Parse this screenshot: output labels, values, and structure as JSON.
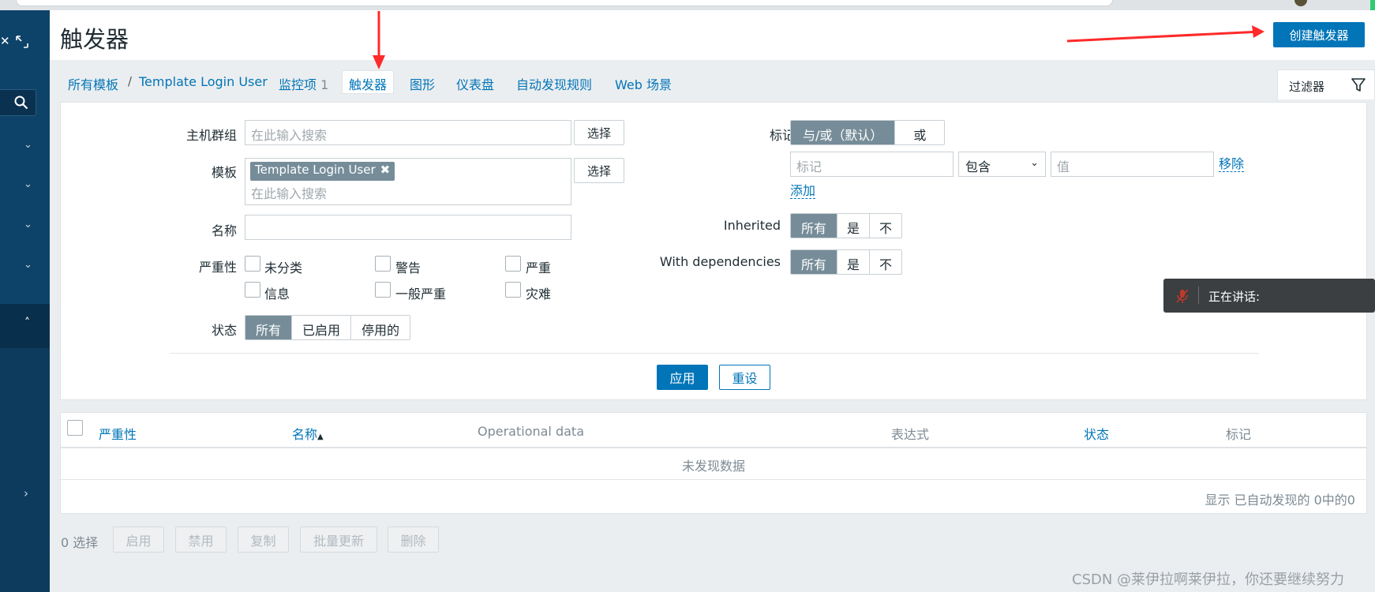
{
  "header": {
    "page_title": "触发器",
    "create_button": "创建触发器"
  },
  "nav": {
    "breadcrumb_all_templates": "所有模板",
    "breadcrumb_sep": "/",
    "breadcrumb_template": "Template Login User",
    "items_label": "监控项",
    "items_count": "1",
    "triggers": "触发器",
    "graphs": "图形",
    "dashboards": "仪表盘",
    "discovery_rules": "自动发现规则",
    "web_scenarios": "Web 场景",
    "filter_tab": "过滤器"
  },
  "filter": {
    "host_group_label": "主机群组",
    "host_group_placeholder": "在此输入搜索",
    "select_button": "选择",
    "template_label": "模板",
    "template_chip": "Template Login User",
    "template_placeholder": "在此输入搜索",
    "name_label": "名称",
    "name_value": "",
    "severity_label": "严重性",
    "severities": [
      "未分类",
      "警告",
      "严重",
      "信息",
      "一般严重",
      "灾难"
    ],
    "status_label": "状态",
    "status_options": [
      "所有",
      "已启用",
      "停用的"
    ],
    "tags_label": "标记",
    "tags_mode_options": [
      "与/或（默认）",
      "或"
    ],
    "tag_placeholder": "标记",
    "tag_operator": "包含",
    "tag_value_placeholder": "值",
    "remove_link": "移除",
    "add_link": "添加",
    "inherited_label": "Inherited",
    "inherited_options": [
      "所有",
      "是",
      "不"
    ],
    "deps_label": "With dependencies",
    "deps_options": [
      "所有",
      "是",
      "不"
    ],
    "apply_button": "应用",
    "reset_button": "重设"
  },
  "toast": {
    "text": "正在讲话:"
  },
  "table": {
    "columns": {
      "severity": "严重性",
      "name": "名称",
      "name_sort": "▲",
      "operational_data": "Operational data",
      "expression": "表达式",
      "status": "状态",
      "tags": "标记"
    },
    "empty_text": "未发现数据",
    "footer": "显示 已自动发现的 0中的0"
  },
  "actions": {
    "selected": "0 选择",
    "enable": "启用",
    "disable": "禁用",
    "copy": "复制",
    "mass_update": "批量更新",
    "delete": "删除"
  },
  "watermark": "CSDN @莱伊拉啊莱伊拉，你还要继续努力",
  "colors": {
    "sidebar": "#0e4369",
    "accent": "#0275b8",
    "annotation_arrow": "#ff2a2a"
  }
}
